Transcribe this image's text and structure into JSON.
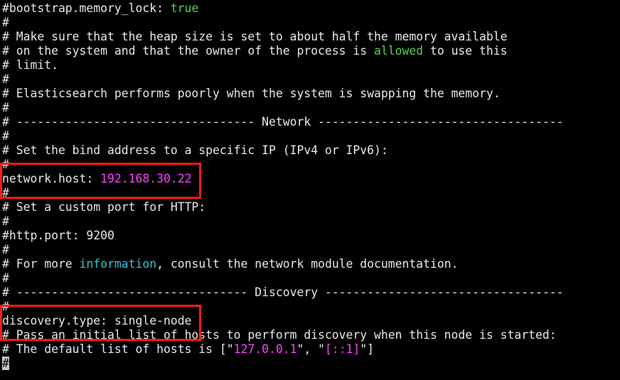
{
  "colors": {
    "background": "#000000",
    "text": "#e8e8e8",
    "value_green": "#55d255",
    "value_magenta": "#ff40ff",
    "keyword_cyan": "#35c0d8",
    "highlight_border": "#ff1a1a"
  },
  "lines": [
    [
      {
        "t": "#bootstrap.memory_lock: "
      },
      {
        "t": "true",
        "c": "green"
      }
    ],
    [
      {
        "t": "#"
      }
    ],
    [
      {
        "t": "# Make sure that the heap size is set to about half the memory available"
      }
    ],
    [
      {
        "t": "# on the system and that the owner of the process is "
      },
      {
        "t": "allowed",
        "c": "green"
      },
      {
        "t": " to use this"
      }
    ],
    [
      {
        "t": "# limit."
      }
    ],
    [
      {
        "t": "#"
      }
    ],
    [
      {
        "t": "# Elasticsearch performs poorly when the system is swapping the memory."
      }
    ],
    [
      {
        "t": "#"
      }
    ],
    [
      {
        "t": "# ---------------------------------- Network -----------------------------------"
      }
    ],
    [
      {
        "t": "#"
      }
    ],
    [
      {
        "t": "# Set the bind address to a specific IP (IPv4 or IPv6):"
      }
    ],
    [
      {
        "t": "#"
      }
    ],
    [
      {
        "t": "network.host: "
      },
      {
        "t": "192.168.30.22",
        "c": "magenta"
      }
    ],
    [
      {
        "t": "#"
      }
    ],
    [
      {
        "t": "# Set a custom port for HTTP:"
      }
    ],
    [
      {
        "t": "#"
      }
    ],
    [
      {
        "t": "#http.port: 9200"
      }
    ],
    [
      {
        "t": "#"
      }
    ],
    [
      {
        "t": "# For more "
      },
      {
        "t": "information",
        "c": "cyan"
      },
      {
        "t": ", consult the network module documentation."
      }
    ],
    [
      {
        "t": "#"
      }
    ],
    [
      {
        "t": "# --------------------------------- Discovery ----------------------------------"
      }
    ],
    [
      {
        "t": "#"
      }
    ],
    [
      {
        "t": "discovery.type: single-node"
      }
    ],
    [
      {
        "t": "# Pass an initial list of hosts to perform discovery when this node is started:"
      }
    ],
    [
      {
        "t": "# The default list of hosts is [\""
      },
      {
        "t": "127.0.0.1",
        "c": "magenta"
      },
      {
        "t": "\", \""
      },
      {
        "t": "[::1]",
        "c": "magenta"
      },
      {
        "t": "\"]"
      }
    ],
    [
      {
        "t": "#",
        "c": "cursor"
      }
    ]
  ],
  "highlights": [
    "network.host",
    "discovery.type"
  ]
}
